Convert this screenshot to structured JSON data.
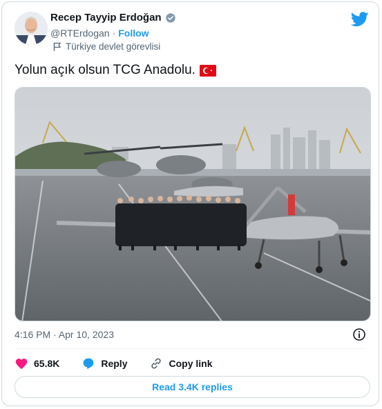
{
  "author": {
    "name": "Recep Tayyip Erdoğan",
    "handle": "@RTErdogan",
    "separator": "·",
    "follow_label": "Follow",
    "account_label": "Türkiye devlet görevlisi"
  },
  "tweet": {
    "text": "Yolun açık olsun TCG Anadolu.",
    "timestamp": "4:16 PM · Apr 10, 2023"
  },
  "actions": {
    "likes": "65.8K",
    "reply_label": "Reply",
    "copy_link_label": "Copy link"
  },
  "replies_button": "Read 3.4K replies",
  "colors": {
    "accent": "#1d9bf0",
    "like": "#f91880",
    "text_secondary": "#536471",
    "verified": "#829aab"
  }
}
